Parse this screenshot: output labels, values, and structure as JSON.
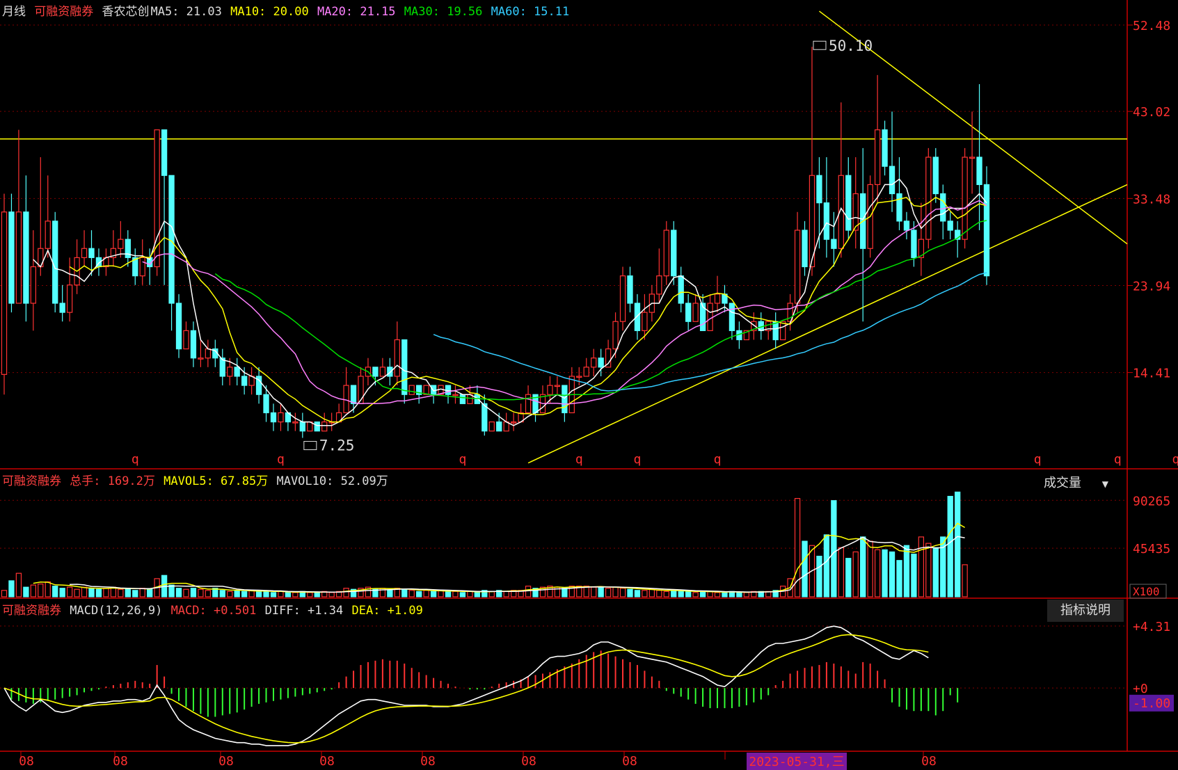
{
  "colors": {
    "up": "#ff3232",
    "down": "#54ffff",
    "ma5": "#ffffff",
    "ma10": "#ffff00",
    "ma20": "#ff80ff",
    "ma30": "#00e000",
    "ma60": "#33ccff",
    "grid": "#800000",
    "axis": "#cc0000",
    "level": "#ffff00",
    "dif": "#ffffff",
    "dea": "#ffff00"
  },
  "main_header": {
    "period": "月线",
    "tag": "可融资融券",
    "name": "香农芯创",
    "ma5": "MA5: 21.03",
    "ma10": "MA10: 20.00",
    "ma20": "MA20: 21.15",
    "ma30": "MA30: 19.56",
    "ma60": "MA60: 15.11"
  },
  "vol_header": {
    "tag": "可融资融券",
    "total": "总手: 169.2万",
    "mavol5": "MAVOL5: 67.85万",
    "mavol10": "MAVOL10: 52.09万",
    "dropdown": "成交量",
    "unit": "X100"
  },
  "macd_header": {
    "tag": "可融资融券",
    "name": "MACD(12,26,9)",
    "macd": "MACD: +0.501",
    "diff": "DIFF: +1.34",
    "dea": "DEA: +1.09",
    "help_button": "指标说明"
  },
  "price_axis": [
    "52.48",
    "43.02",
    "33.48",
    "23.94",
    "14.41"
  ],
  "volume_axis": [
    "90265",
    "45435"
  ],
  "macd_axis": [
    "+4.31",
    "+0",
    "-1.00"
  ],
  "x_axis_labels": [
    "08",
    "08",
    "08",
    "08",
    "08",
    "08",
    "08",
    "08",
    "08"
  ],
  "cursor_date": "2023-05-31,三",
  "annotations": {
    "high": "50.10",
    "low": "7.25"
  },
  "q_marker": "q",
  "chart_data": [
    {
      "type": "candlestick",
      "title": "月线",
      "series_note": "monthly candles",
      "ylim": [
        4.5,
        54
      ],
      "bars": [
        [
          14.2,
          32,
          34,
          12
        ],
        [
          32,
          22,
          34,
          21
        ],
        [
          22,
          32,
          41,
          22
        ],
        [
          32,
          22,
          36,
          20
        ],
        [
          22,
          26,
          30,
          19
        ],
        [
          26,
          28,
          38,
          25
        ],
        [
          28,
          31,
          36,
          27
        ],
        [
          31,
          22,
          32,
          21
        ],
        [
          22,
          21,
          24,
          20
        ],
        [
          21,
          24,
          27,
          20
        ],
        [
          24,
          27,
          29,
          23
        ],
        [
          27,
          28,
          30,
          26
        ],
        [
          28,
          27,
          30,
          25
        ],
        [
          27,
          26,
          28,
          25
        ],
        [
          26,
          27,
          28,
          25
        ],
        [
          27,
          28,
          30,
          26
        ],
        [
          28,
          29,
          31,
          27
        ],
        [
          29,
          27,
          30,
          26
        ],
        [
          27,
          25,
          28,
          24
        ],
        [
          25,
          27,
          29,
          24
        ],
        [
          27,
          26,
          28,
          24
        ],
        [
          26,
          41,
          41,
          25
        ],
        [
          41,
          36,
          41,
          24
        ],
        [
          36,
          22,
          36,
          19
        ],
        [
          22,
          17,
          23,
          16
        ],
        [
          17,
          19,
          20,
          17
        ],
        [
          19,
          16,
          20,
          15
        ],
        [
          16,
          16,
          18,
          15
        ],
        [
          16,
          17,
          18,
          15
        ],
        [
          17,
          16,
          18,
          15
        ],
        [
          16,
          14,
          17,
          13
        ],
        [
          14,
          15,
          16,
          13
        ],
        [
          15,
          14,
          16,
          13
        ],
        [
          14,
          13,
          15,
          12
        ],
        [
          13,
          14,
          15,
          12
        ],
        [
          14,
          12,
          15,
          11
        ],
        [
          12,
          10,
          13,
          9
        ],
        [
          10,
          9,
          11,
          8
        ],
        [
          9,
          10,
          11,
          8
        ],
        [
          10,
          9,
          10,
          8
        ],
        [
          9,
          9,
          10,
          8
        ],
        [
          9,
          8,
          10,
          7.25
        ],
        [
          8,
          9,
          9,
          8
        ],
        [
          9,
          8,
          9,
          8
        ],
        [
          8,
          9,
          10,
          8
        ],
        [
          9,
          9,
          10,
          8
        ],
        [
          9,
          10,
          11,
          9
        ],
        [
          10,
          13,
          15,
          10
        ],
        [
          13,
          11,
          13,
          10
        ],
        [
          11,
          14,
          15,
          11
        ],
        [
          14,
          15,
          16,
          13
        ],
        [
          15,
          14,
          15,
          13
        ],
        [
          14,
          15,
          16,
          14
        ],
        [
          15,
          14,
          16,
          13
        ],
        [
          14,
          18,
          20,
          13
        ],
        [
          18,
          12,
          18,
          11
        ],
        [
          12,
          13,
          13,
          12
        ],
        [
          13,
          12,
          13,
          11
        ],
        [
          12,
          13,
          13,
          12
        ],
        [
          13,
          12,
          13,
          11
        ],
        [
          12,
          13,
          13,
          12
        ],
        [
          13,
          12,
          13,
          11
        ],
        [
          12,
          12,
          13,
          11
        ],
        [
          12,
          11,
          12,
          11
        ],
        [
          11,
          12,
          13,
          11
        ],
        [
          12,
          11,
          13,
          11
        ],
        [
          11,
          8,
          12,
          7.5
        ],
        [
          8,
          9,
          9,
          8
        ],
        [
          9,
          8,
          10,
          8
        ],
        [
          8,
          9,
          10,
          8
        ],
        [
          9,
          9,
          10,
          8
        ],
        [
          9,
          10,
          11,
          9
        ],
        [
          10,
          12,
          13,
          10
        ],
        [
          12,
          10,
          12,
          9
        ],
        [
          10,
          12,
          13,
          10
        ],
        [
          12,
          13,
          14,
          11
        ],
        [
          13,
          13,
          14,
          12
        ],
        [
          13,
          10,
          13,
          9
        ],
        [
          10,
          14,
          15,
          10
        ],
        [
          14,
          14,
          15,
          13
        ],
        [
          14,
          15,
          16,
          14
        ],
        [
          15,
          16,
          17,
          14
        ],
        [
          16,
          15,
          17,
          14
        ],
        [
          15,
          17,
          18,
          15
        ],
        [
          17,
          20,
          21,
          16
        ],
        [
          20,
          25,
          26,
          19
        ],
        [
          25,
          22,
          26,
          21
        ],
        [
          22,
          19,
          23,
          18
        ],
        [
          19,
          21,
          23,
          18
        ],
        [
          21,
          23,
          24,
          20
        ],
        [
          23,
          25,
          28,
          22
        ],
        [
          25,
          30,
          31,
          24
        ],
        [
          30,
          25,
          31,
          24
        ],
        [
          25,
          22,
          26,
          21
        ],
        [
          22,
          20,
          23,
          19
        ],
        [
          20,
          22,
          23,
          20
        ],
        [
          22,
          19,
          23,
          19
        ],
        [
          19,
          22,
          23,
          19
        ],
        [
          22,
          23,
          25,
          21
        ],
        [
          23,
          22,
          24,
          21
        ],
        [
          22,
          19,
          22,
          18
        ],
        [
          19,
          18,
          20,
          17
        ],
        [
          18,
          19,
          19,
          18
        ],
        [
          19,
          20,
          21,
          18
        ],
        [
          20,
          19,
          21,
          18
        ],
        [
          19,
          20,
          20,
          18
        ],
        [
          20,
          18,
          21,
          17
        ],
        [
          18,
          20,
          20,
          18
        ],
        [
          20,
          22,
          23,
          19
        ],
        [
          22,
          30,
          32,
          21
        ],
        [
          30,
          26,
          31,
          25
        ],
        [
          26,
          36,
          50.1,
          25
        ],
        [
          36,
          33,
          38,
          28
        ],
        [
          33,
          29,
          38,
          27
        ],
        [
          29,
          28,
          32,
          26
        ],
        [
          28,
          36,
          44,
          27
        ],
        [
          36,
          30,
          38,
          29
        ],
        [
          30,
          34,
          38,
          28
        ],
        [
          34,
          28,
          39,
          20
        ],
        [
          28,
          35,
          36,
          27
        ],
        [
          35,
          41,
          47,
          33
        ],
        [
          41,
          37,
          42,
          36
        ],
        [
          37,
          34,
          43,
          32
        ],
        [
          34,
          31,
          38,
          30
        ],
        [
          31,
          30,
          32,
          29
        ],
        [
          30,
          27,
          31,
          26
        ],
        [
          27,
          29,
          33,
          25
        ],
        [
          29,
          38,
          39,
          28
        ],
        [
          38,
          34,
          39,
          33
        ],
        [
          34,
          31,
          35,
          29
        ],
        [
          31,
          30,
          32,
          29
        ],
        [
          30,
          29,
          31,
          27
        ],
        [
          29,
          38,
          39,
          28
        ],
        [
          38,
          38,
          43,
          34
        ],
        [
          38,
          35,
          46,
          30
        ],
        [
          35,
          25,
          37,
          24
        ]
      ],
      "ma_series": [
        "MA5",
        "MA10",
        "MA20",
        "MA30",
        "MA60"
      ],
      "high_label": 50.1,
      "low_label": 7.25
    },
    {
      "type": "bar",
      "title": "成交量",
      "ylim": [
        0,
        95000
      ],
      "values": [
        6000,
        15000,
        22000,
        9000,
        11000,
        12000,
        14000,
        10000,
        8000,
        9000,
        7000,
        9000,
        8000,
        7000,
        8000,
        9000,
        7000,
        8000,
        6000,
        8000,
        7000,
        17000,
        20000,
        11000,
        8000,
        7000,
        8000,
        7000,
        6000,
        8000,
        6000,
        5000,
        6000,
        5000,
        6000,
        5000,
        5000,
        4000,
        5000,
        4000,
        4000,
        5000,
        4000,
        4000,
        5000,
        4000,
        5000,
        8000,
        7000,
        8000,
        9000,
        7000,
        8000,
        6000,
        8000,
        7000,
        6000,
        5000,
        6000,
        5000,
        6000,
        5000,
        5000,
        4000,
        5000,
        4000,
        6000,
        5000,
        6000,
        5000,
        6000,
        6000,
        10000,
        8000,
        9000,
        10000,
        9000,
        8000,
        10000,
        10000,
        10000,
        9000,
        9000,
        8000,
        9000,
        8000,
        7000,
        6000,
        6000,
        7000,
        6000,
        5000,
        6000,
        5000,
        5000,
        4000,
        5000,
        5000,
        4000,
        4000,
        5000,
        4000,
        4000,
        5000,
        5000,
        5000,
        6000,
        10000,
        17000,
        92000,
        52000,
        48000,
        38000,
        58000,
        90000,
        46000,
        36000,
        42000,
        56000,
        52000,
        44000,
        44000,
        42000,
        34000,
        48000,
        40000,
        56000,
        50000,
        46000,
        56000,
        94000,
        98000,
        30000
      ]
    },
    {
      "type": "bar",
      "title": "MACD(12,26,9)",
      "ylim": [
        -4.2,
        4.5
      ],
      "macd": [
        0,
        -0.8,
        -0.9,
        -1.0,
        -1.1,
        -1.0,
        -0.9,
        -0.8,
        -0.7,
        -0.6,
        -0.5,
        -0.3,
        -0.2,
        -0.1,
        0.1,
        0.2,
        0.3,
        0.4,
        0.5,
        0.4,
        0.3,
        1.6,
        0.8,
        -0.4,
        -0.9,
        -1.3,
        -1.6,
        -1.8,
        -2.0,
        -2.0,
        -1.9,
        -1.8,
        -1.7,
        -1.5,
        -1.3,
        -1.1,
        -1.0,
        -0.9,
        -0.8,
        -0.7,
        -0.6,
        -0.5,
        -0.4,
        -0.3,
        -0.2,
        -0.1,
        0.4,
        0.8,
        1.2,
        1.6,
        1.8,
        1.9,
        2.0,
        1.9,
        1.9,
        1.7,
        1.4,
        1.1,
        0.9,
        0.7,
        0.5,
        0.3,
        0.1,
        0,
        -0.1,
        -0.1,
        -0.1,
        0.1,
        0.3,
        0.4,
        0.5,
        0.6,
        0.8,
        0.9,
        1.0,
        1.1,
        1.3,
        1.5,
        1.7,
        2.0,
        2.3,
        2.5,
        2.6,
        2.4,
        2.2,
        2.0,
        1.8,
        1.6,
        1.2,
        0.8,
        0.5,
        -0.2,
        -0.4,
        -0.6,
        -0.8,
        -1.1,
        -1.3,
        -1.4,
        -1.4,
        -1.4,
        -1.4,
        -1.3,
        -1.2,
        -1.0,
        -0.8,
        -0.5,
        0.2,
        0.5,
        1.0,
        1.2,
        1.4,
        1.5,
        1.6,
        1.8,
        1.7,
        1.5,
        1.2,
        1.0,
        1.8,
        1.7,
        1.2,
        0.6,
        -1.0,
        -1.3,
        -1.5,
        -1.6,
        -1.6,
        -1.6,
        -1.9,
        -1.6,
        -0.5,
        -1.0
      ],
      "diff": [
        0,
        -0.9,
        -1.3,
        -1.6,
        -1.2,
        -0.8,
        -1.2,
        -1.6,
        -1.7,
        -1.6,
        -1.4,
        -1.2,
        -1.1,
        -1.0,
        -1.0,
        -0.9,
        -0.9,
        -0.8,
        -0.8,
        -0.9,
        -0.7,
        0.2,
        -0.5,
        -1.4,
        -2.2,
        -2.6,
        -2.9,
        -3.1,
        -3.3,
        -3.5,
        -3.6,
        -3.7,
        -3.8,
        -3.8,
        -3.9,
        -3.9,
        -4.0,
        -4.0,
        -4.0,
        -4.0,
        -3.9,
        -3.7,
        -3.4,
        -3.0,
        -2.6,
        -2.2,
        -1.8,
        -1.5,
        -1.2,
        -0.9,
        -0.8,
        -0.8,
        -0.9,
        -1.0,
        -1.1,
        -1.2,
        -1.2,
        -1.2,
        -1.2,
        -1.3,
        -1.3,
        -1.3,
        -1.2,
        -1.1,
        -0.9,
        -0.7,
        -0.5,
        -0.3,
        -0.1,
        0.1,
        0.3,
        0.5,
        0.8,
        1.2,
        1.7,
        2.1,
        2.2,
        2.2,
        2.3,
        2.4,
        2.6,
        3.0,
        3.2,
        3.2,
        3.0,
        2.8,
        2.5,
        2.2,
        2.1,
        2.0,
        1.9,
        1.8,
        1.6,
        1.4,
        1.2,
        1.0,
        0.8,
        0.5,
        0.2,
        0.1,
        0.5,
        1.0,
        1.5,
        2.0,
        2.5,
        2.9,
        3.1,
        3.1,
        3.2,
        3.3,
        3.4,
        3.6,
        3.9,
        4.2,
        4.3,
        4.2,
        3.9,
        3.5,
        3.3,
        3.0,
        2.7,
        2.4,
        2.1,
        2.0,
        2.3,
        2.6,
        2.4,
        2.1
      ]
    }
  ]
}
